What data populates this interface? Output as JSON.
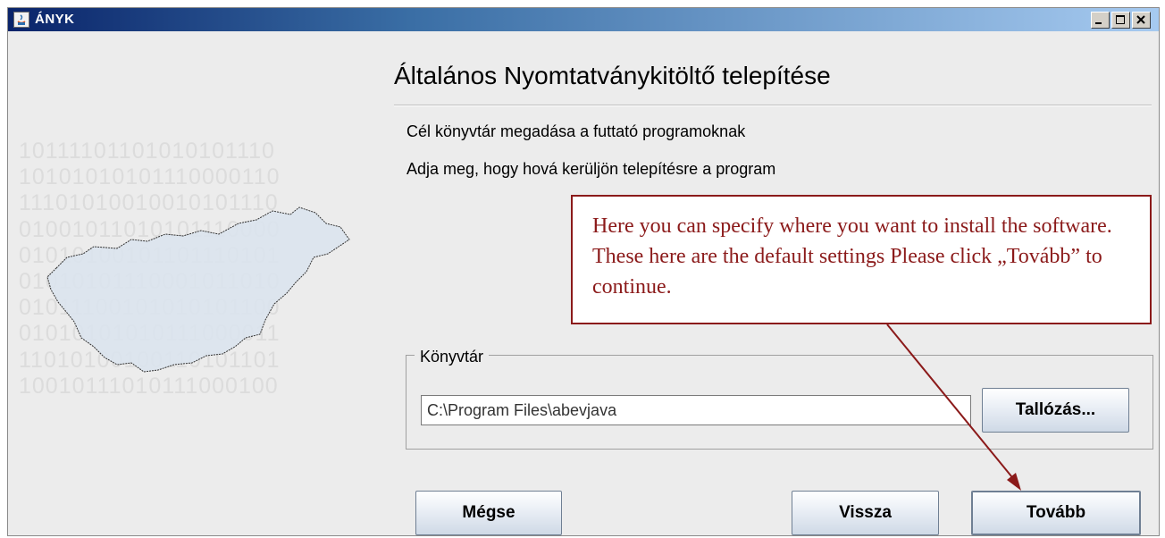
{
  "window": {
    "title": "ÁNYK"
  },
  "art": {
    "binary_lines": [
      "10111101101010101110",
      "10101010101110000110",
      "11101010010010101110",
      "01001011010101110000",
      "01010100101101110101",
      "01010101110001011010",
      "01011100101010101100",
      "01010101010111000011",
      "11010100100110101101",
      "10010111010111000100"
    ]
  },
  "main": {
    "title": "Általános Nyomtatványkitöltő telepítése",
    "line1": "Cél könyvtár megadása a futtató programoknak",
    "line2": "Adja meg, hogy hová kerüljön telepítésre a program"
  },
  "directory": {
    "legend": "Könyvtár",
    "path_value": "C:\\Program Files\\abevjava",
    "browse_label": "Tallózás..."
  },
  "buttons": {
    "cancel": "Mégse",
    "back": "Vissza",
    "next": "Tovább"
  },
  "callout": {
    "text": "Here you can specify where you want to install the software. These here are the default settings Please click „Tovább” to continue."
  },
  "colors": {
    "callout": "#8b1a1a",
    "titlebar_start": "#0a246a",
    "titlebar_end": "#a6caf0"
  }
}
